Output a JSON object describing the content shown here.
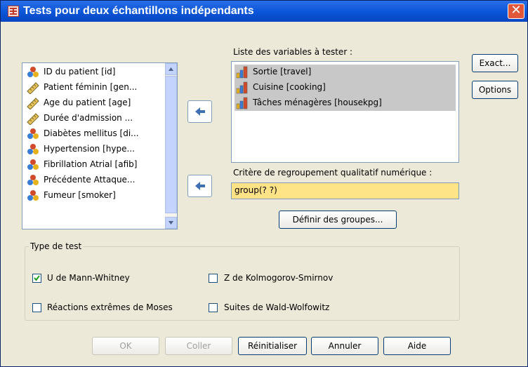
{
  "window": {
    "title": "Tests pour deux échantillons indépendants",
    "close": "✕"
  },
  "source_list": {
    "items": [
      {
        "label": "ID du patient [id]",
        "icon": "nominal-icon"
      },
      {
        "label": "Patient féminin [gen...",
        "icon": "scale-icon"
      },
      {
        "label": "Age du patient [age]",
        "icon": "scale-icon"
      },
      {
        "label": "Durée d'admission ...",
        "icon": "scale-icon"
      },
      {
        "label": "Diabètes mellitus [di...",
        "icon": "nominal-icon"
      },
      {
        "label": "Hypertension [hype...",
        "icon": "nominal-icon"
      },
      {
        "label": "Fibrillation Atrial  [afib]",
        "icon": "nominal-icon"
      },
      {
        "label": "Précédente Attaque...",
        "icon": "nominal-icon"
      },
      {
        "label": "Fumeur [smoker]",
        "icon": "nominal-icon"
      }
    ]
  },
  "test_vars": {
    "label": "Liste des variables à tester :",
    "items": [
      {
        "label": "Sortie [travel]",
        "icon": "ordinal-icon"
      },
      {
        "label": "Cuisine [cooking]",
        "icon": "ordinal-icon"
      },
      {
        "label": "Tâches ménagères [housekpg]",
        "icon": "ordinal-icon"
      }
    ]
  },
  "grouping": {
    "label": "Critère de regroupement qualitatif numérique :",
    "value": "group(? ?)",
    "define_button": "Définir des groupes..."
  },
  "side_buttons": {
    "exact": "Exact...",
    "options": "Options"
  },
  "test_type": {
    "legend": "Type de test",
    "options": [
      {
        "label": "U de Mann-Whitney",
        "checked": true
      },
      {
        "label": "Z de Kolmogorov-Smirnov",
        "checked": false
      },
      {
        "label": "Réactions extrêmes de Moses",
        "checked": false
      },
      {
        "label": "Suites de Wald-Wolfowitz",
        "checked": false
      }
    ]
  },
  "footer": {
    "ok": "OK",
    "paste": "Coller",
    "reset": "Réinitialiser",
    "cancel": "Annuler",
    "help": "Aide"
  },
  "colors": {
    "titlebar": "#0a55d8",
    "field_bg": "#ffe386",
    "selection_bg": "#c8c8c8"
  }
}
